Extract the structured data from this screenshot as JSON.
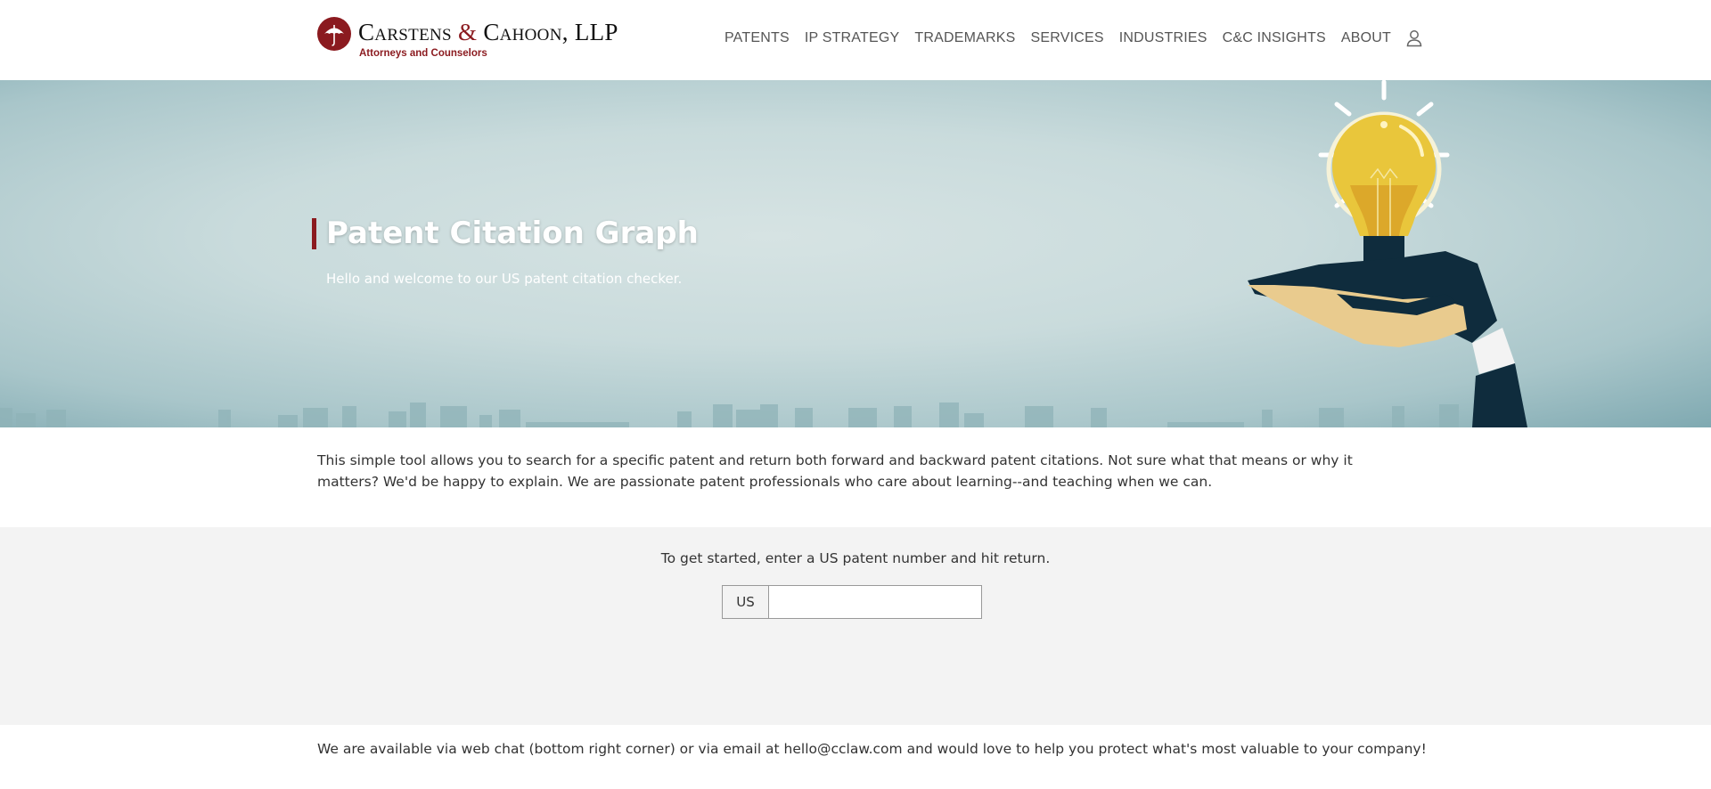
{
  "brand": {
    "name_part1": "Carstens",
    "ampersand": "&",
    "name_part2": "Cahoon, LLP",
    "tagline": "Attorneys and Counselors",
    "color": "#8b1a1f"
  },
  "nav": {
    "items": [
      "PATENTS",
      "IP STRATEGY",
      "TRADEMARKS",
      "SERVICES",
      "INDUSTRIES",
      "C&C INSIGHTS",
      "ABOUT"
    ],
    "account_icon": "user-icon"
  },
  "hero": {
    "title": "Patent Citation Graph",
    "subtitle": "Hello and welcome to our US patent citation checker."
  },
  "intro": {
    "text": "This simple tool allows you to search for a specific patent and return both forward and backward patent citations. Not sure what that means or why it matters? We'd be happy to explain. We are passionate patent professionals who care about learning--and teaching when we can."
  },
  "search": {
    "prompt": "To get started, enter a US patent number and hit return.",
    "prefix": "US",
    "value": "",
    "placeholder": ""
  },
  "footer": {
    "note": "We are available via web chat (bottom right corner) or via email at hello@cclaw.com and would love to help you protect what's most valuable to your company!"
  }
}
